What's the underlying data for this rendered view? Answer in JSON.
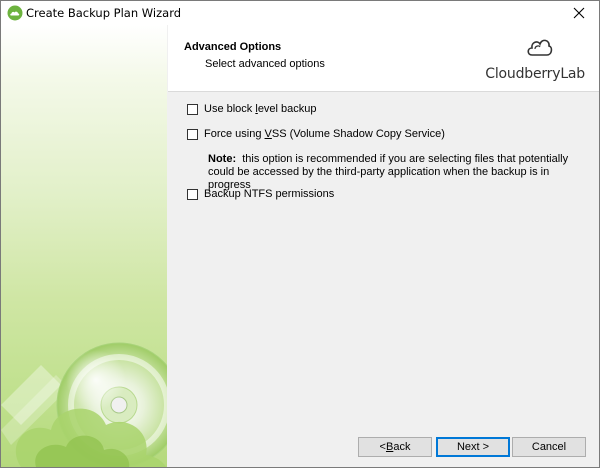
{
  "window": {
    "title": "Create Backup Plan Wizard",
    "close_glyph": "✕"
  },
  "header": {
    "title": "Advanced Options",
    "subtitle": "Select advanced options",
    "logo_text": "CloudberryLab"
  },
  "options": [
    {
      "label_pre": "Use block ",
      "label_u": "l",
      "label_post": "evel backup",
      "checked": false
    },
    {
      "label_pre": "Force using ",
      "label_u": "V",
      "label_post": "SS (Volume Shadow Copy Service)",
      "checked": false
    },
    {
      "label_pre": "Backup NTFS permissions",
      "label_u": "",
      "label_post": "",
      "checked": false
    }
  ],
  "note": {
    "label": "Note:",
    "text": "this option is recommended if you are selecting files that potentially could be accessed by the third-party application when the backup is in progress"
  },
  "buttons": {
    "back_pre": "< ",
    "back_u": "B",
    "back_post": "ack",
    "next_label": "Next >",
    "cancel_label": "Cancel"
  },
  "colors": {
    "accent": "#0078d7",
    "sidebar_green": "#b5d97d"
  }
}
